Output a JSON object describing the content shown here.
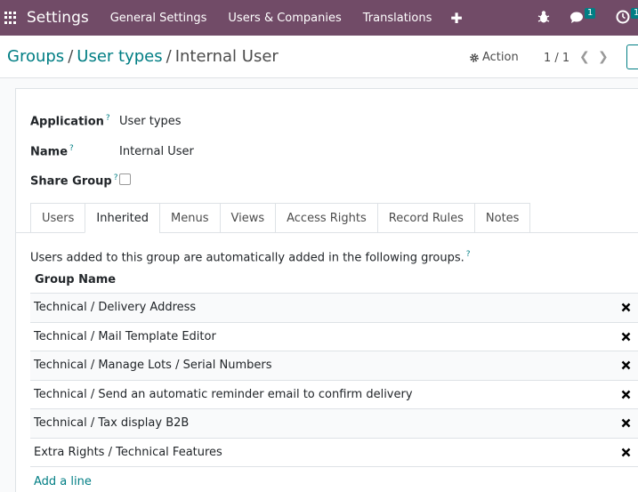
{
  "navbar": {
    "brand": "Settings",
    "menu": [
      "General Settings",
      "Users & Companies",
      "Translations"
    ],
    "chat_badge": "1",
    "activity_badge": "1"
  },
  "breadcrumb": {
    "items": [
      "Groups",
      "User types",
      "Internal User"
    ],
    "separator": "/"
  },
  "control": {
    "action_label": "Action",
    "pager": "1 / 1"
  },
  "form": {
    "application_label": "Application",
    "application_value": "User types",
    "name_label": "Name",
    "name_value": "Internal User",
    "share_label": "Share Group",
    "help_mark": "?"
  },
  "tabs": [
    "Users",
    "Inherited",
    "Menus",
    "Views",
    "Access Rights",
    "Record Rules",
    "Notes"
  ],
  "active_tab": "Inherited",
  "inherited": {
    "intro": "Users added to this group are automatically added in the following groups.",
    "column": "Group Name",
    "rows": [
      "Technical / Delivery Address",
      "Technical / Mail Template Editor",
      "Technical / Manage Lots / Serial Numbers",
      "Technical / Send an automatic reminder email to confirm delivery",
      "Technical / Tax display B2B",
      "Extra Rights / Technical Features"
    ],
    "add_line": "Add a line"
  },
  "colors": {
    "navbar": "#714b67",
    "accent": "#017e84"
  }
}
